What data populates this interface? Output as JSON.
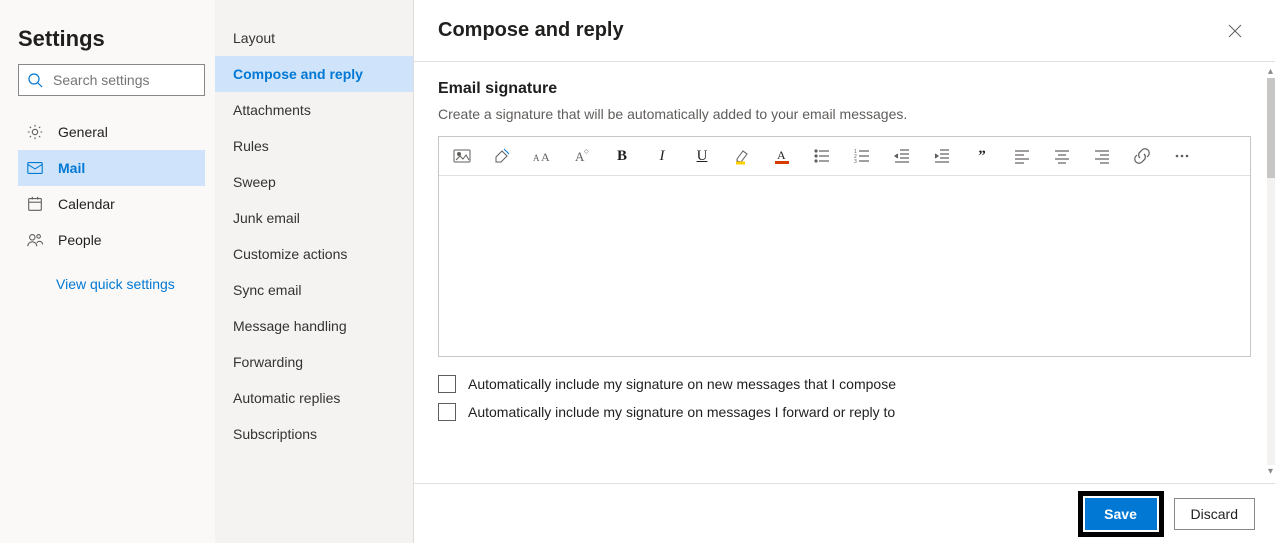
{
  "left": {
    "title": "Settings",
    "search_placeholder": "Search settings",
    "nav": [
      {
        "label": "General"
      },
      {
        "label": "Mail"
      },
      {
        "label": "Calendar"
      },
      {
        "label": "People"
      }
    ],
    "quick_link": "View quick settings"
  },
  "middle": {
    "items": [
      "Layout",
      "Compose and reply",
      "Attachments",
      "Rules",
      "Sweep",
      "Junk email",
      "Customize actions",
      "Sync email",
      "Message handling",
      "Forwarding",
      "Automatic replies",
      "Subscriptions"
    ]
  },
  "main": {
    "title": "Compose and reply",
    "section_title": "Email signature",
    "section_desc": "Create a signature that will be automatically added to your email messages.",
    "check1": "Automatically include my signature on new messages that I compose",
    "check2": "Automatically include my signature on messages I forward or reply to",
    "save": "Save",
    "discard": "Discard"
  }
}
